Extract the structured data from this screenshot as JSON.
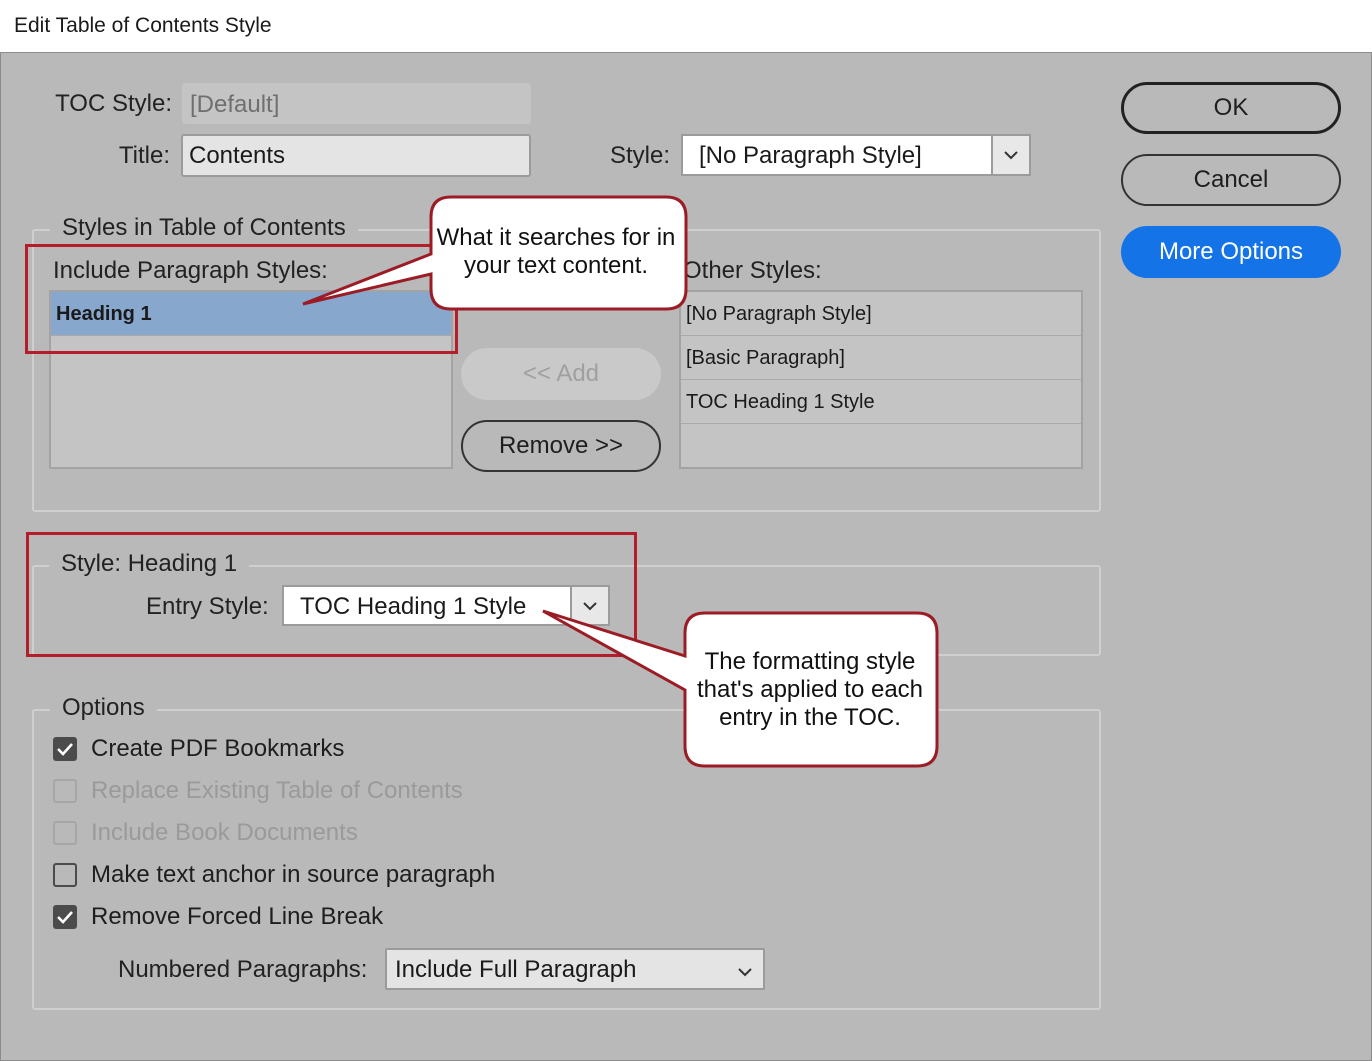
{
  "window": {
    "title": "Edit Table of Contents Style"
  },
  "header": {
    "toc_style_label": "TOC Style:",
    "toc_style_value": "[Default]",
    "title_label": "Title:",
    "title_value": "Contents",
    "style_label": "Style:",
    "style_value": "[No Paragraph Style]"
  },
  "buttons": {
    "ok": "OK",
    "cancel": "Cancel",
    "more_options": "More Options",
    "add": "<< Add",
    "remove": "Remove >>"
  },
  "styles_group": {
    "legend": "Styles in Table of Contents",
    "include_label": "Include Paragraph Styles:",
    "include_items": [
      "Heading 1"
    ],
    "other_label": "Other Styles:",
    "other_items": [
      "[No Paragraph Style]",
      "[Basic Paragraph]",
      "TOC Heading 1 Style"
    ]
  },
  "style_heading": {
    "legend": "Style: Heading 1",
    "entry_style_label": "Entry Style:",
    "entry_style_value": "TOC Heading 1 Style"
  },
  "options": {
    "legend": "Options",
    "checkboxes": [
      {
        "label": "Create PDF Bookmarks",
        "checked": true,
        "enabled": true
      },
      {
        "label": "Replace Existing Table of Contents",
        "checked": false,
        "enabled": false
      },
      {
        "label": "Include Book Documents",
        "checked": false,
        "enabled": false
      },
      {
        "label": "Make text anchor in source paragraph",
        "checked": false,
        "enabled": true
      },
      {
        "label": "Remove Forced Line Break",
        "checked": true,
        "enabled": true
      }
    ],
    "numbered_paragraphs_label": "Numbered Paragraphs:",
    "numbered_paragraphs_value": "Include Full Paragraph"
  },
  "annotations": {
    "callout_1": "What it searches for in your text content.",
    "callout_2": "The formatting style that's applied to each entry in the TOC.",
    "highlight_color": "#b41e2a"
  },
  "colors": {
    "dialog_bg": "#b9b9b9",
    "selected_row": "#87a7cd",
    "primary_blue": "#1473e6"
  }
}
